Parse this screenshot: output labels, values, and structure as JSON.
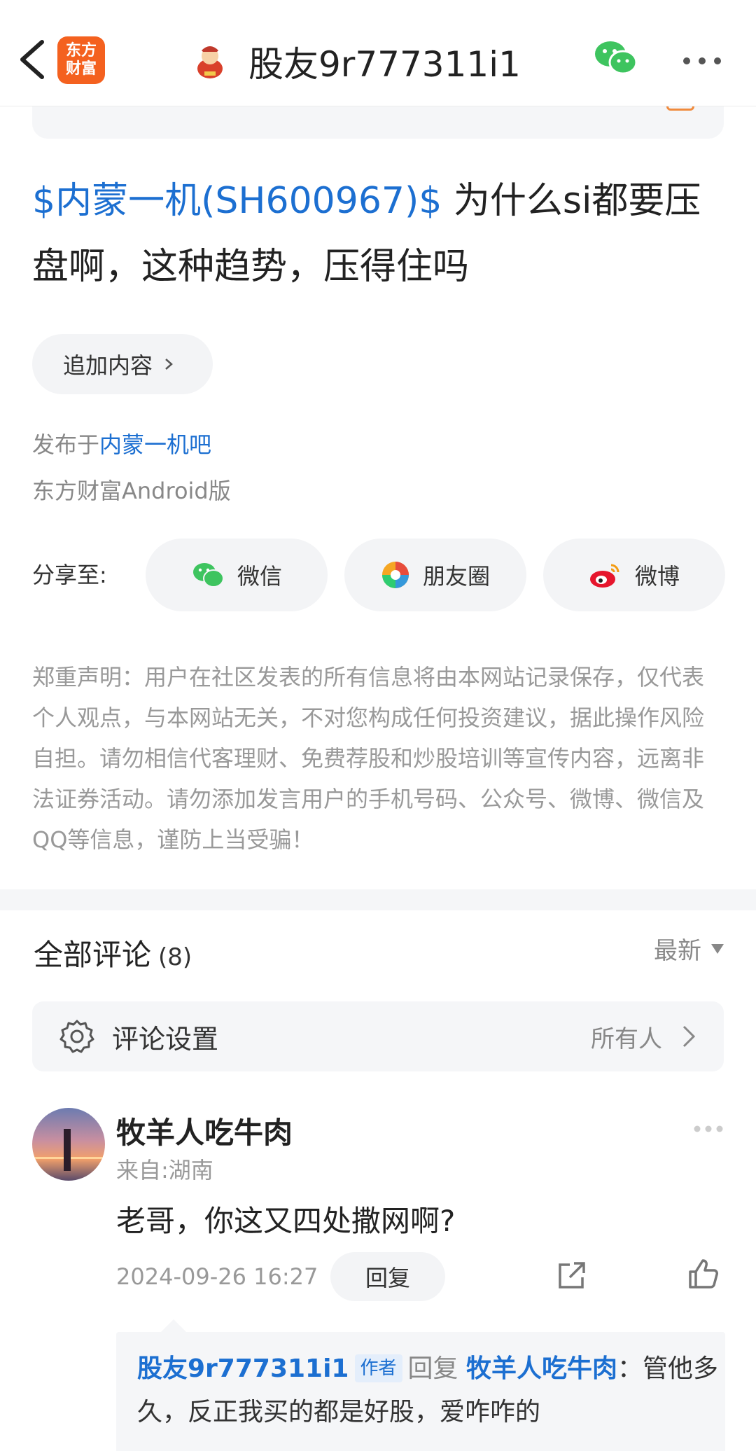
{
  "header": {
    "logo_text_line1": "东方",
    "logo_text_line2": "财富",
    "title": "股友9r777311i1"
  },
  "post": {
    "stock_tag": "$内蒙一机(SH600967)$",
    "text": " 为什么si都要压盘啊，这种趋势，压得住吗",
    "add_content_label": "追加内容",
    "published_prefix": "发布于",
    "published_bar": "内蒙一机吧",
    "source": "东方财富Android版"
  },
  "share": {
    "label": "分享至:",
    "wechat": "微信",
    "moments": "朋友圈",
    "weibo": "微博"
  },
  "disclaimer": "郑重声明：用户在社区发表的所有信息将由本网站记录保存，仅代表个人观点，与本网站无关，不对您构成任何投资建议，据此操作风险自担。请勿相信代客理财、免费荐股和炒股培训等宣传内容，远离非法证券活动。请勿添加发言用户的手机号码、公众号、微博、微信及QQ等信息，谨防上当受骗！",
  "comments": {
    "title": "全部评论",
    "count": "(8)",
    "sort": "最新",
    "settings_label": "评论设置",
    "settings_value": "所有人",
    "items": [
      {
        "user": "牧羊人吃牛肉",
        "location": "来自:湖南",
        "text": "老哥，你这又四处撒网啊?",
        "time": "2024-09-26 16:27",
        "reply_label": "回复",
        "reply": {
          "author": "股友9r777311i1",
          "author_tag": "作者",
          "verb": "回复",
          "target": "牧羊人吃牛肉",
          "text": "：管他多久，反正我买的都是好股，爱咋咋的"
        }
      }
    ]
  },
  "colors": {
    "link_blue": "#1c6fd1",
    "brand_orange": "#f4611f"
  }
}
